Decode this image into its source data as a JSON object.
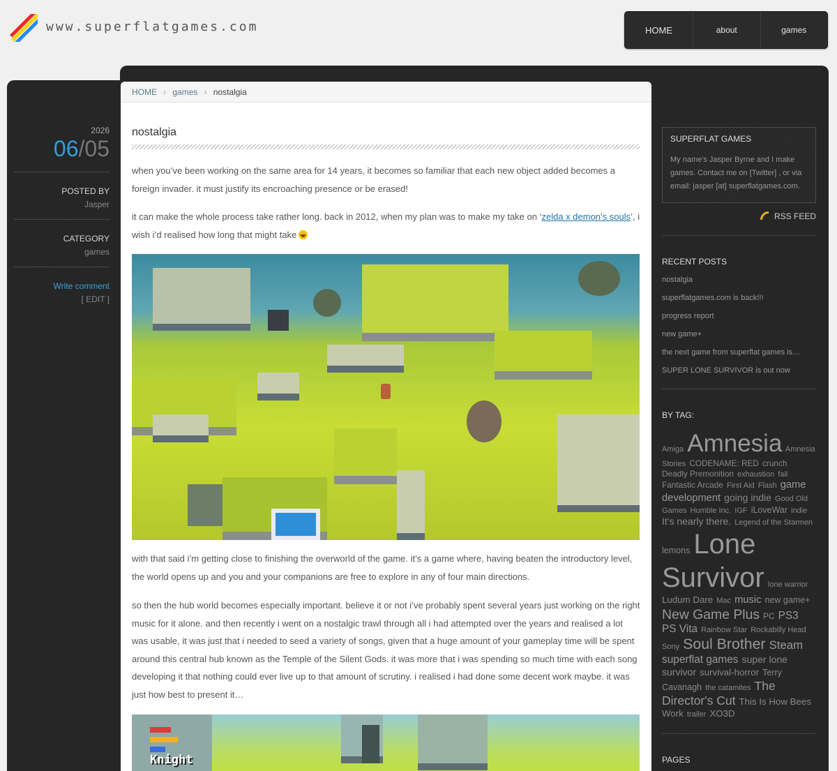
{
  "site": {
    "url": "www.superflatgames.com",
    "stripe_colors": [
      "#e82a2a",
      "#f6d40a",
      "#2a8ae8"
    ]
  },
  "nav": [
    {
      "label": "HOME"
    },
    {
      "label": "about"
    },
    {
      "label": "games"
    }
  ],
  "breadcrumb": {
    "home": "HOME",
    "section": "games",
    "current": "nostalgia"
  },
  "post": {
    "title": "nostalgia",
    "p1": "when you’ve been working on the same area for 14 years, it becomes so familiar that each new object added becomes a foreign invader. it must justify its encroaching presence or be erased!",
    "p2_pre": "it can make the whole process take rather long. back in 2012, when my plan was to make my take on ‘",
    "p2_link": "zelda x demon’s souls",
    "p2_post": "’, i wish i’d realised how long that might take",
    "p3": "with that said i’m getting close to finishing the overworld of the game. it’s a game where, having beaten the introductory level, the world opens up and you and your companions are free to explore in any of four main directions.",
    "p4": "so then the hub world becomes especially important. believe it or not i’ve probably spent several years just working on the right music for it alone. and then recently i went on a nostalgic trawl through all i had attempted over the years and realised a lot was usable, it was just that i needed to seed a variety of songs, given that a huge amount of your gameplay time will be spent around this central hub known as the Temple of the Silent Gods. it was more that i was spending so much time with each song developing it that nothing could ever live up to that amount of scrutiny. i realised i had done some decent work maybe. it was just how best to present it…",
    "shot2_label": "Knight"
  },
  "meta": {
    "year": "2026",
    "month": "06",
    "sep": "/",
    "day": "05",
    "posted_by_label": "POSTED BY",
    "author": "Jasper",
    "category_label": "CATEGORY",
    "category": "games",
    "write_comment": "Write comment",
    "edit": "[ EDIT ]"
  },
  "sidebar": {
    "about_title": "SUPERFLAT GAMES",
    "about_text": "My name's Jasper Byrne and I make games. Contact me on [Twitter] , or via email: jasper [at] superflatgames.com.",
    "rss": "RSS FEED",
    "recent_title": "RECENT POSTS",
    "recent": [
      "nostalgia",
      "superflatgames.com is back!!!",
      "progress report",
      "new game+",
      "the next game from superflat games is…",
      "SUPER LONE SURVIVOR is out now"
    ],
    "tags_title": "BY TAG:",
    "tags": [
      {
        "t": "Amiga",
        "s": 1
      },
      {
        "t": "Amnesia",
        "s": 5
      },
      {
        "t": "Amnesia Stories",
        "s": 1
      },
      {
        "t": "CODENAME: RED",
        "s": 1.1
      },
      {
        "t": "crunch",
        "s": 1.1
      },
      {
        "t": "Deadly Premonition",
        "s": 1.1
      },
      {
        "t": "exhaustion",
        "s": 1
      },
      {
        "t": "fail",
        "s": 1
      },
      {
        "t": "Fantastic Arcade",
        "s": 1.1
      },
      {
        "t": "First Aid",
        "s": 1
      },
      {
        "t": "Flash",
        "s": 1
      },
      {
        "t": "game development",
        "s": 1.5
      },
      {
        "t": "going indie",
        "s": 1.4
      },
      {
        "t": "Good Old Games",
        "s": 1
      },
      {
        "t": "Humble Inc.",
        "s": 1
      },
      {
        "t": "IGF",
        "s": 1
      },
      {
        "t": "iLoveWar",
        "s": 1.2
      },
      {
        "t": "indie",
        "s": 1
      },
      {
        "t": "It's nearly there.",
        "s": 1.4
      },
      {
        "t": "Legend of the Starmen",
        "s": 1
      },
      {
        "t": "lemons",
        "s": 1.2
      },
      {
        "t": "Lone Survivor",
        "s": 6
      },
      {
        "t": "lone warrior",
        "s": 1
      },
      {
        "t": "Ludum Dare",
        "s": 1.3
      },
      {
        "t": "Mac",
        "s": 1
      },
      {
        "t": "music",
        "s": 1.5
      },
      {
        "t": "new game+",
        "s": 1.2
      },
      {
        "t": "New Game Plus",
        "s": 2.2
      },
      {
        "t": "PC",
        "s": 1.1
      },
      {
        "t": "PS3",
        "s": 1.6
      },
      {
        "t": "PS Vita",
        "s": 1.6
      },
      {
        "t": "Rainbow Star",
        "s": 1
      },
      {
        "t": "Rockabilly Head",
        "s": 1
      },
      {
        "t": "Sony",
        "s": 1
      },
      {
        "t": "Soul Brother",
        "s": 2.5
      },
      {
        "t": "Steam",
        "s": 1.8
      },
      {
        "t": "superflat games",
        "s": 1.6
      },
      {
        "t": "super lone survivor",
        "s": 1.4
      },
      {
        "t": "survival-horror",
        "s": 1.3
      },
      {
        "t": "Terry Cavanagh",
        "s": 1.2
      },
      {
        "t": "the catamites",
        "s": 1
      },
      {
        "t": "The Director's Cut",
        "s": 1.9
      },
      {
        "t": "This Is How Bees Work",
        "s": 1.3
      },
      {
        "t": "trailer",
        "s": 1
      },
      {
        "t": "XO3D",
        "s": 1.3
      }
    ],
    "pages_title": "PAGES"
  }
}
